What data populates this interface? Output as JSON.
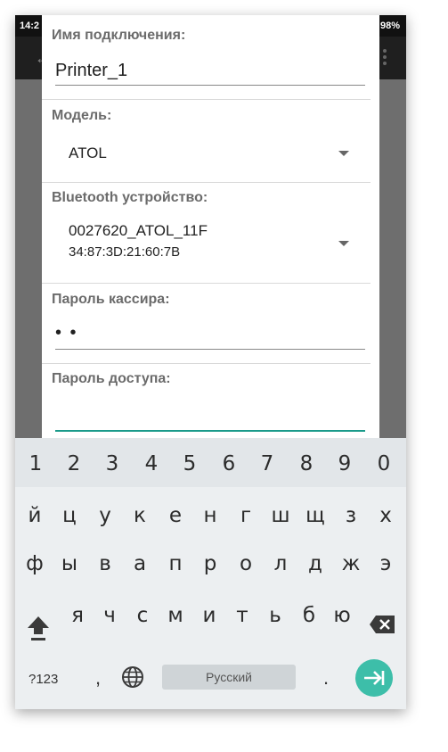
{
  "status_bar": {
    "time": "14:2",
    "battery": "98%"
  },
  "dialog": {
    "connection_name": {
      "label": "Имя подключения:",
      "value": "Printer_1"
    },
    "model": {
      "label": "Модель:",
      "value": "ATOL"
    },
    "bluetooth": {
      "label": "Bluetooth устройство:",
      "device_name": "0027620_ATOL_11F",
      "device_mac": "34:87:3D:21:60:7B"
    },
    "cashier_password": {
      "label": "Пароль кассира:",
      "value": "• •"
    },
    "access_password": {
      "label": "Пароль доступа:",
      "value": ""
    }
  },
  "keyboard": {
    "number_row": [
      "1",
      "2",
      "3",
      "4",
      "5",
      "6",
      "7",
      "8",
      "9",
      "0"
    ],
    "row1": [
      "й",
      "ц",
      "у",
      "к",
      "е",
      "н",
      "г",
      "ш",
      "щ",
      "з",
      "х"
    ],
    "row2": [
      "ф",
      "ы",
      "в",
      "а",
      "п",
      "р",
      "о",
      "л",
      "д",
      "ж",
      "э"
    ],
    "row3": [
      "я",
      "ч",
      "с",
      "м",
      "и",
      "т",
      "ь",
      "б",
      "ю"
    ],
    "symbols_label": "?123",
    "comma": ",",
    "space_label": "Русский",
    "period": ".",
    "accent_color": "#3dbea9"
  },
  "colors": {
    "focus_underline": "#1a9a8a",
    "label_gray": "#6b6b6b"
  }
}
